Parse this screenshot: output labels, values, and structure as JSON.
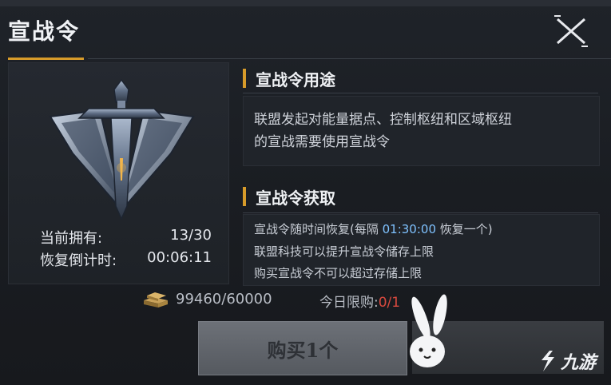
{
  "header": {
    "title": "宣战令"
  },
  "left": {
    "stats": [
      {
        "label": "当前拥有:",
        "value": "13/30"
      },
      {
        "label": "恢复倒计时:",
        "value": "00:06:11"
      }
    ]
  },
  "usage": {
    "title": "宣战令用途",
    "lines": [
      "联盟发起对能量据点、控制枢纽和区域枢纽",
      "的宣战需要使用宣战令"
    ]
  },
  "acquire": {
    "title": "宣战令获取",
    "line1_prefix": "宣战令随时间恢复(每隔 ",
    "line1_time": "01:30:00",
    "line1_suffix": " 恢复一个)",
    "line2": "联盟科技可以提升宣战令储存上限",
    "line3": "购买宣战令不可以超过存储上限"
  },
  "footer": {
    "currency": "99460/60000",
    "limit_label": "今日限购:",
    "limit_value": "0/1",
    "buy_label": "购买1个"
  },
  "watermark": {
    "text": "九游"
  },
  "colors": {
    "accent": "#d79b2a",
    "highlight": "#7fc2ff",
    "warning": "#d84a3f"
  }
}
